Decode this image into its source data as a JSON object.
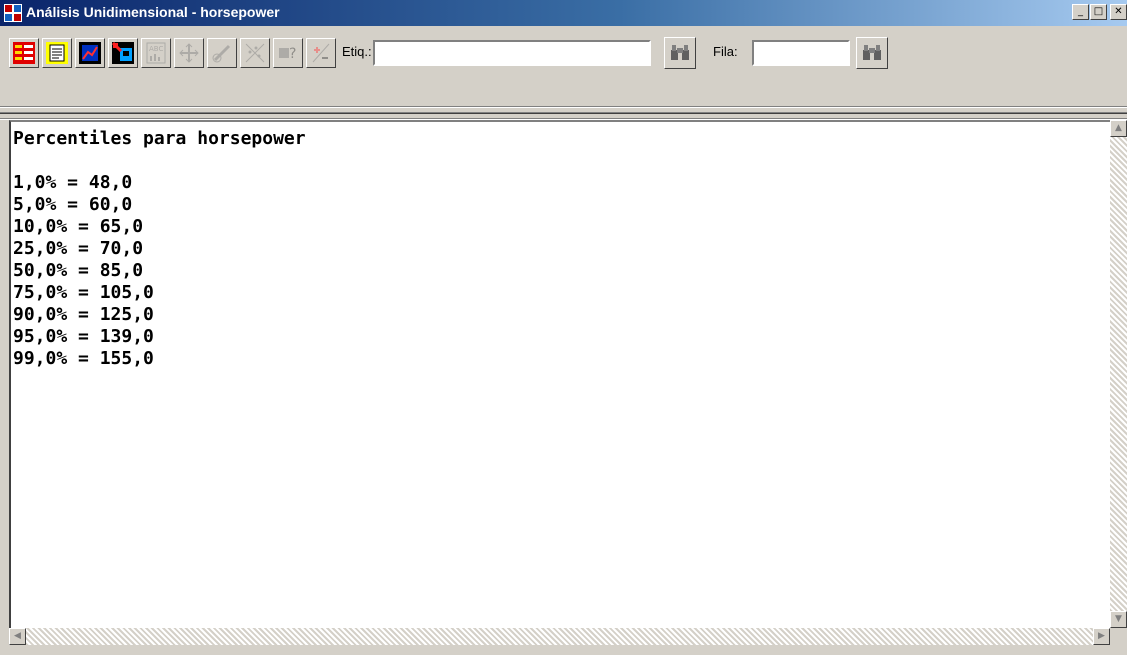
{
  "window": {
    "title": "Análisis Unidimensional - horsepower",
    "controls": {
      "minimize": "_",
      "maximize": "□",
      "close": "✕"
    }
  },
  "toolbar": {
    "tools": [
      {
        "name": "input-dialog-tool",
        "icon": "input-dialog-icon",
        "enabled": true
      },
      {
        "name": "analysis-options-tool",
        "icon": "text-report-icon",
        "enabled": true
      },
      {
        "name": "graphs-tool",
        "icon": "line-graph-icon",
        "enabled": true
      },
      {
        "name": "save-results-tool",
        "icon": "save-results-icon",
        "enabled": true
      },
      {
        "name": "pane-options-tool",
        "icon": "abc-text-icon",
        "enabled": false
      },
      {
        "name": "move-tool",
        "icon": "move-arrows-icon",
        "enabled": false
      },
      {
        "name": "brush-tool",
        "icon": "brush-icon",
        "enabled": false
      },
      {
        "name": "exclude-tool",
        "icon": "scatter-exclude-icon",
        "enabled": false
      },
      {
        "name": "identify-tool",
        "icon": "question-mark-icon",
        "enabled": false
      },
      {
        "name": "add-remove-tool",
        "icon": "plus-minus-icon",
        "enabled": false
      }
    ],
    "label_field": {
      "label": "Etiq.:",
      "value": ""
    },
    "row_field": {
      "label": "Fila:",
      "value": ""
    }
  },
  "output": {
    "heading": "Percentiles para horsepower",
    "lines": [
      "1,0% = 48,0",
      "5,0% = 60,0",
      "10,0% = 65,0",
      "25,0% = 70,0",
      "50,0% = 85,0",
      "75,0% = 105,0",
      "90,0% = 125,0",
      "95,0% = 139,0",
      "99,0% = 155,0"
    ]
  },
  "scrollbars": {
    "up": "▲",
    "down": "▼",
    "left": "◀",
    "right": "▶"
  },
  "colors": {
    "titlebar_start": "#0a246a",
    "titlebar_end": "#a6caf0",
    "face": "#d4d0c8"
  }
}
